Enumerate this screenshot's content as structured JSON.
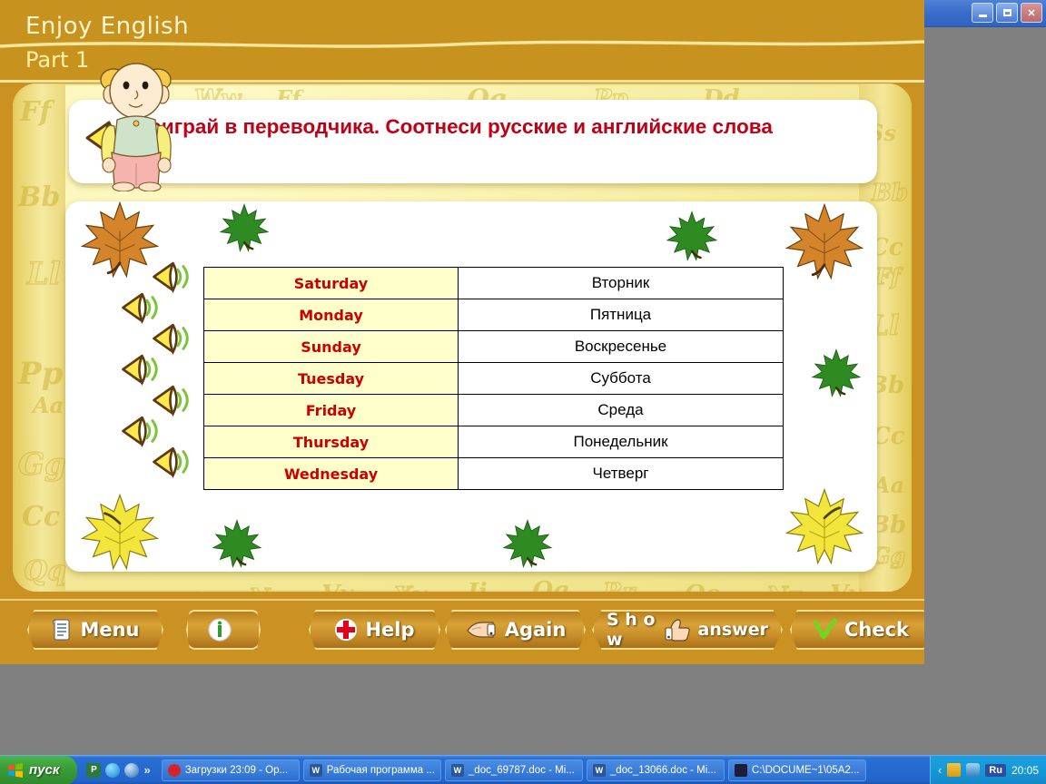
{
  "window": {
    "controls": [
      {
        "name": "minimize",
        "label": "_"
      },
      {
        "name": "maximize",
        "label": "❐"
      },
      {
        "name": "close",
        "label": "✕"
      }
    ]
  },
  "header": {
    "title_line1": "Enjoy English",
    "title_line2": "Part 1",
    "mascot_name": "cartoon-boy"
  },
  "task": {
    "speaker_icon": "speaker-icon",
    "text": "Поиграй в переводчика. Соотнеси русские и английские слова"
  },
  "exercise": {
    "rows": [
      {
        "english": "Saturday",
        "russian": "Вторник"
      },
      {
        "english": "Monday",
        "russian": "Пятница"
      },
      {
        "english": "Sunday",
        "russian": "Воскресенье"
      },
      {
        "english": "Tuesday",
        "russian": "Суббота"
      },
      {
        "english": "Friday",
        "russian": "Среда"
      },
      {
        "english": "Thursday",
        "russian": "Понедельник"
      },
      {
        "english": "Wednesday",
        "russian": "Четверг"
      }
    ],
    "speaker_count": 7,
    "speaker_icon": "speaker-icon"
  },
  "decorations": {
    "leaves": [
      {
        "name": "maple-leaf-orange",
        "color": "#D4842B"
      },
      {
        "name": "maple-leaf-green",
        "color": "#2E8B22"
      },
      {
        "name": "maple-leaf-yellow",
        "color": "#F2E53C"
      }
    ]
  },
  "toolbar": {
    "buttons": [
      {
        "name": "menu-button",
        "label": "Menu",
        "icon": "scroll-icon"
      },
      {
        "name": "info-button",
        "label": "",
        "icon": "info-icon"
      },
      {
        "name": "help-button",
        "label": "Help",
        "icon": "red-cross-icon"
      },
      {
        "name": "again-button",
        "label": "Again",
        "icon": "pointing-hand-icon"
      },
      {
        "name": "show-answer-button",
        "label": "S h o w     answer",
        "icon": "thumbs-up-icon"
      },
      {
        "name": "check-button",
        "label": "Check",
        "icon": "green-check-icon"
      }
    ]
  },
  "taskbar": {
    "start_label": "пуск",
    "quick_launch": [
      "word-icon",
      "globe-icon",
      "ie-icon",
      "more-chevrons"
    ],
    "tasks": [
      {
        "label": "Загрузки 23:09 - Op...",
        "icon": "opera-icon"
      },
      {
        "label": "Рабочая программа ...",
        "icon": "word-icon"
      },
      {
        "label": "_doc_69787.doc - Mi...",
        "icon": "word-icon"
      },
      {
        "label": "_doc_13066.doc - Mi...",
        "icon": "word-icon"
      },
      {
        "label": "C:\\DOCUME~1\\05A2...",
        "icon": "folder-icon"
      }
    ],
    "tray": {
      "language": "Ru",
      "clock": "20:05"
    }
  },
  "colors": {
    "header_gold": "#C8921E",
    "page_yellow": "#F7EFA6",
    "english_red": "#CC0000",
    "task_red": "#C00014",
    "cell_yellow": "#FFFFCC"
  }
}
